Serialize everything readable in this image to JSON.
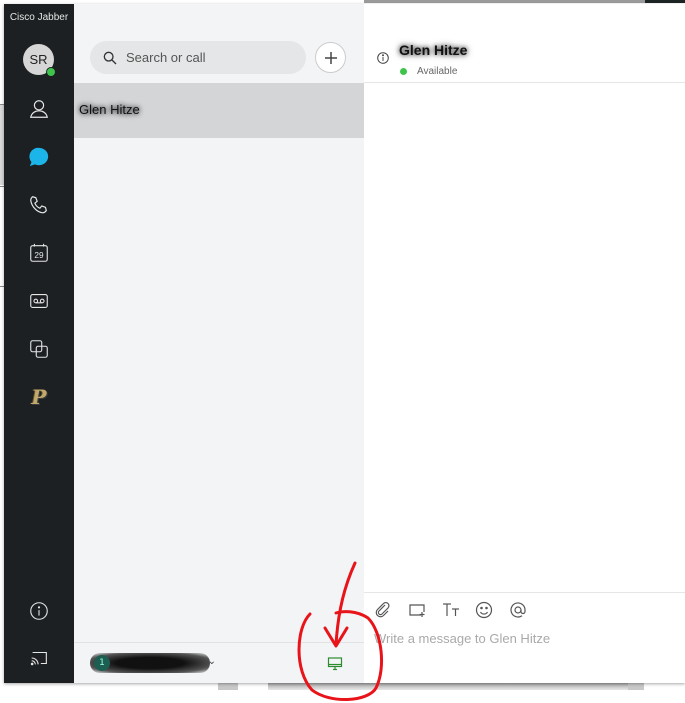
{
  "app": {
    "title": "Cisco Jabber"
  },
  "user": {
    "initials": "SR",
    "presence_color": "#3ec44b"
  },
  "rail": {
    "items": [
      {
        "name": "contacts",
        "icon": "person-icon"
      },
      {
        "name": "chats",
        "icon": "chat-bubble-icon",
        "active": true,
        "color": "#1cb5ea"
      },
      {
        "name": "calls",
        "icon": "phone-icon"
      },
      {
        "name": "meetings",
        "icon": "calendar-icon",
        "calendar_day": "29"
      },
      {
        "name": "voicemail",
        "icon": "voicemail-icon"
      },
      {
        "name": "custom-tabs",
        "icon": "overlap-squares-icon"
      },
      {
        "name": "purdue",
        "icon": "purdue-logo-icon",
        "glyph": "P"
      }
    ],
    "bottom": [
      {
        "name": "info",
        "icon": "info-icon"
      },
      {
        "name": "cast",
        "icon": "cast-icon"
      }
    ]
  },
  "search": {
    "placeholder": "Search or call",
    "value": ""
  },
  "add_button": {
    "label": "+"
  },
  "conversations": [
    {
      "name": "Glen Hitze",
      "selected": true
    }
  ],
  "footer": {
    "account_initial": "1",
    "account_label": "redacted",
    "device_icon_color": "#2e8b2e"
  },
  "chat": {
    "contact_name": "Glen Hitze",
    "status": "Available",
    "status_color": "#3ec44b",
    "composer_placeholder": "Write a message to Glen Hitze",
    "composer_value": "",
    "tools": [
      "attach-icon",
      "screen-capture-icon",
      "text-format-icon",
      "emoji-icon",
      "mention-icon"
    ],
    "tool_glyphs": {
      "format": "Tт",
      "mention": "@"
    }
  },
  "annotation": {
    "color": "#e8141a",
    "description": "red circle with arrow pointing at device icon"
  }
}
